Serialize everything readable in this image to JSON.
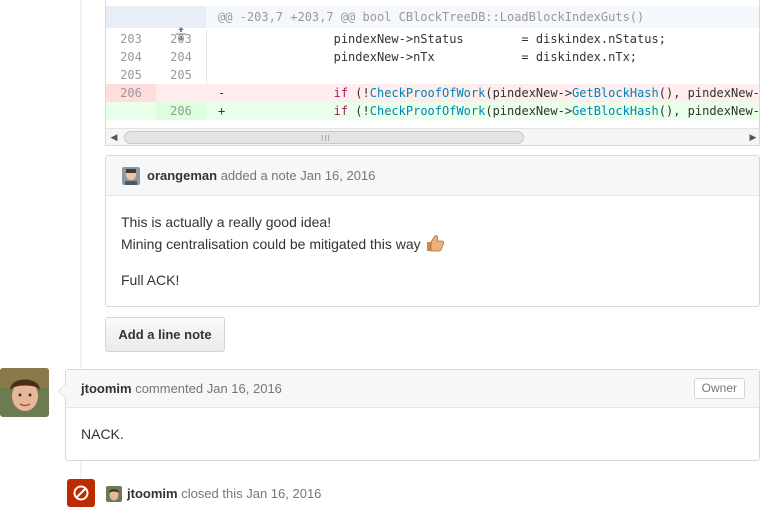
{
  "diff": {
    "hunk_header": "@@ -203,7 +203,7 @@ bool CBlockTreeDB::LoadBlockIndexGuts()",
    "rows": [
      {
        "old": "203",
        "new": "203",
        "sign": " ",
        "code": "                pindexNew->nStatus        = diskindex.nStatus;"
      },
      {
        "old": "204",
        "new": "204",
        "sign": " ",
        "code": "                pindexNew->nTx            = diskindex.nTx;"
      },
      {
        "old": "205",
        "new": "205",
        "sign": " ",
        "code": ""
      },
      {
        "old": "206",
        "new": "",
        "sign": "-",
        "code_kw": "if",
        "code_a": " (!",
        "code_fn1": "CheckProofOfWork",
        "code_b": "(pindexNew->",
        "code_fn2": "GetBlockHash",
        "code_c": "(), pindexNew->r"
      },
      {
        "old": "",
        "new": "206",
        "sign": "+",
        "code_kw": "if",
        "code_a": " (!",
        "code_fn1": "CheckProofOfWork",
        "code_b": "(pindexNew->",
        "code_fn2": "GetBlockHash",
        "code_c": "(), pindexNew->r"
      }
    ],
    "scroll_grip": "III"
  },
  "line_note": {
    "author": "orangeman",
    "action": "added a note",
    "date": "Jan 16, 2016",
    "body_line1": "This is actually a really good idea!",
    "body_line2": "Mining centralisation could be mitigated this way",
    "body_line3": "Full ACK!"
  },
  "add_line_note_button": "Add a line note",
  "comment": {
    "author": "jtoomim",
    "action": "commented",
    "date": "Jan 16, 2016",
    "badge": "Owner",
    "body": "NACK."
  },
  "closed_event": {
    "author": "jtoomim",
    "action": "closed this",
    "date": "Jan 16, 2016"
  },
  "colors": {
    "deleted_bg": "#ffecec",
    "added_bg": "#eaffea",
    "closed_badge": "#bd2c00",
    "keyword": "#a71d5d",
    "function": "#0086b3"
  }
}
